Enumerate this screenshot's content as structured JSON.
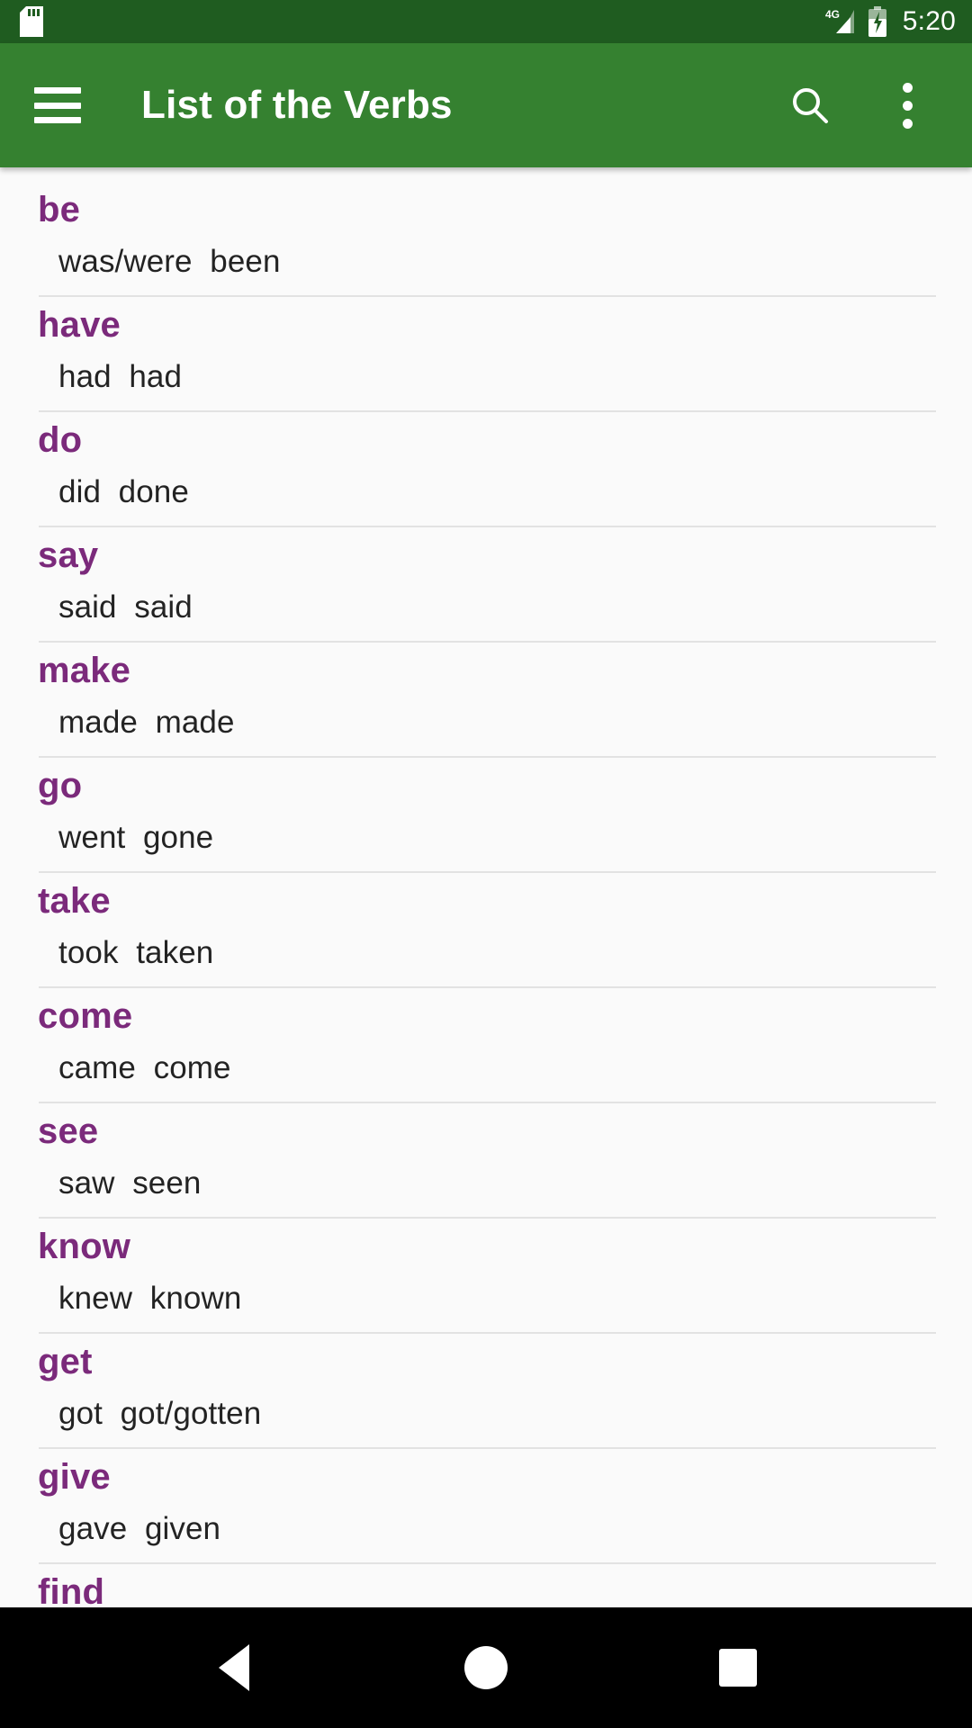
{
  "statusbar": {
    "sd_icon": "sd-card-icon",
    "network_label": "4G",
    "signal_icon": "signal-bars-icon",
    "battery_icon": "battery-charging-icon",
    "time": "5:20"
  },
  "toolbar": {
    "menu_icon": "hamburger-menu-icon",
    "title": "List of the Verbs",
    "search_icon": "search-icon",
    "overflow_icon": "overflow-menu-icon",
    "background_color": "#358130"
  },
  "colors": {
    "status_bar": "#1f5c20",
    "app_bar": "#358130",
    "verb_accent": "#7b2a7b",
    "forms_text": "#232323",
    "divider": "#e2e2e2",
    "page_background": "#fafafa"
  },
  "list": {
    "items": [
      {
        "base": "be",
        "forms": "was/were  been"
      },
      {
        "base": "have",
        "forms": "had  had"
      },
      {
        "base": "do",
        "forms": "did  done"
      },
      {
        "base": "say",
        "forms": "said  said"
      },
      {
        "base": "make",
        "forms": "made  made"
      },
      {
        "base": "go",
        "forms": "went  gone"
      },
      {
        "base": "take",
        "forms": "took  taken"
      },
      {
        "base": "come",
        "forms": "came  come"
      },
      {
        "base": "see",
        "forms": "saw  seen"
      },
      {
        "base": "know",
        "forms": "knew  known"
      },
      {
        "base": "get",
        "forms": "got  got/gotten"
      },
      {
        "base": "give",
        "forms": "gave  given"
      },
      {
        "base": "find",
        "forms": ""
      }
    ]
  },
  "navbar": {
    "back_label": "back-button",
    "home_label": "home-button",
    "recents_label": "recents-button"
  }
}
